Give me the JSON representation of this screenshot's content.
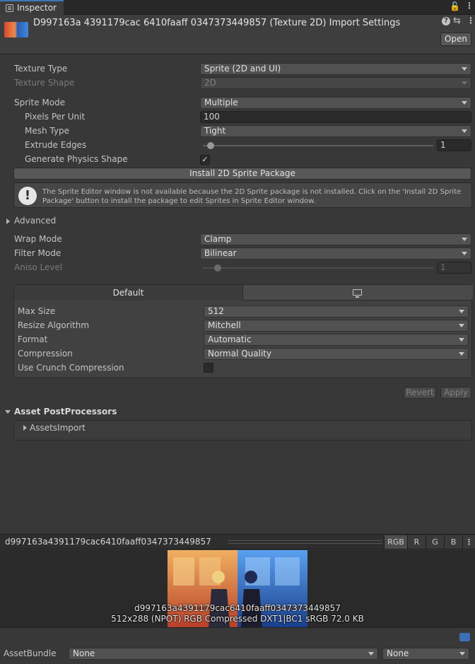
{
  "tab": {
    "label": "Inspector"
  },
  "header": {
    "title": "D997163a 4391179cac 6410faaff 0347373449857 (Texture 2D) Import Settings",
    "open_label": "Open"
  },
  "fields": {
    "texture_type": {
      "label": "Texture Type",
      "value": "Sprite (2D and UI)"
    },
    "texture_shape": {
      "label": "Texture Shape",
      "value": "2D"
    },
    "sprite_mode": {
      "label": "Sprite Mode",
      "value": "Multiple"
    },
    "pixels_per_unit": {
      "label": "Pixels Per Unit",
      "value": "100"
    },
    "mesh_type": {
      "label": "Mesh Type",
      "value": "Tight"
    },
    "extrude_edges": {
      "label": "Extrude Edges",
      "value": "1"
    },
    "generate_physics_shape": {
      "label": "Generate Physics Shape",
      "checked": true
    },
    "install_button": "Install 2D Sprite Package",
    "help_text": "The Sprite Editor window is not available because the 2D Sprite package is not installed. Click on the 'Install 2D Sprite Package' button to install the package to edit Sprites in Sprite Editor window.",
    "advanced": "Advanced",
    "wrap_mode": {
      "label": "Wrap Mode",
      "value": "Clamp"
    },
    "filter_mode": {
      "label": "Filter Mode",
      "value": "Bilinear"
    },
    "aniso_level": {
      "label": "Aniso Level",
      "value": "1"
    }
  },
  "platform": {
    "default_tab": "Default",
    "max_size": {
      "label": "Max Size",
      "value": "512"
    },
    "resize_algorithm": {
      "label": "Resize Algorithm",
      "value": "Mitchell"
    },
    "format": {
      "label": "Format",
      "value": "Automatic"
    },
    "compression": {
      "label": "Compression",
      "value": "Normal Quality"
    },
    "use_crunch": {
      "label": "Use Crunch Compression",
      "checked": false
    }
  },
  "actions": {
    "revert": "Revert",
    "apply": "Apply"
  },
  "post_processors": {
    "title": "Asset PostProcessors",
    "item": "AssetsImport"
  },
  "preview": {
    "title": "d997163a4391179cac6410faaff0347373449857",
    "channels": [
      "RGB",
      "R",
      "G",
      "B"
    ],
    "name_line": "d997163a4391179cac6410faaff0347373449857",
    "info_line": "512x288 (NPOT)  RGB Compressed DXT1|BC1 sRGB   72.0 KB"
  },
  "asset_bundle": {
    "label": "AssetBundle",
    "name_value": "None",
    "variant_value": "None"
  },
  "colors": {
    "accent": "#3a79bb",
    "background": "#383838"
  }
}
